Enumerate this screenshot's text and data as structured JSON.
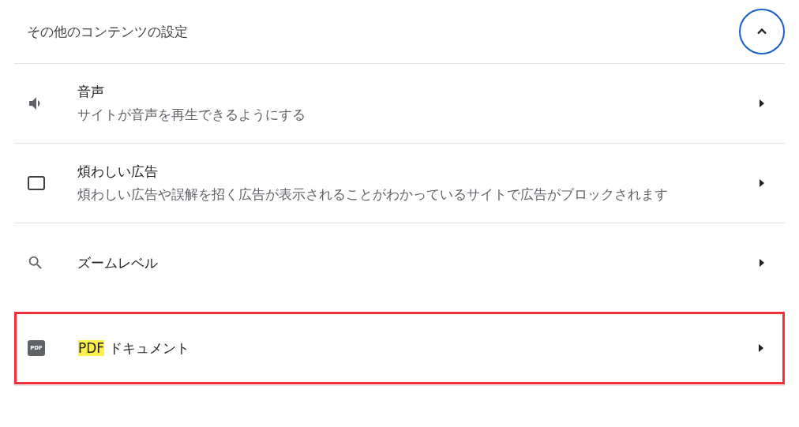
{
  "section": {
    "title": "その他のコンテンツの設定",
    "expanded": true
  },
  "items": [
    {
      "kind": "sound",
      "title": "音声",
      "description": "サイトが音声を再生できるようにする",
      "outlined": false
    },
    {
      "kind": "ads",
      "title": "煩わしい広告",
      "description": "煩わしい広告や誤解を招く広告が表示されることがわかっているサイトで広告がブロックされます",
      "outlined": false
    },
    {
      "kind": "zoom",
      "title": "ズームレベル",
      "outlined": false
    },
    {
      "kind": "pdf",
      "icon_text": "PDF",
      "title_highlight": "PDF",
      "title": "ドキュメント",
      "outlined": true
    }
  ]
}
